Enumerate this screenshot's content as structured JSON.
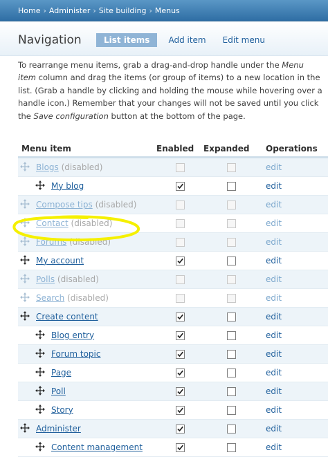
{
  "breadcrumb": [
    "Home",
    "Administer",
    "Site building",
    "Menus"
  ],
  "page_title": "Navigation",
  "tabs": [
    {
      "label": "List items",
      "active": true
    },
    {
      "label": "Add item",
      "active": false
    },
    {
      "label": "Edit menu",
      "active": false
    }
  ],
  "help": {
    "t1": "To rearrange menu items, grab a drag-and-drop handle under the ",
    "em1": "Menu item",
    "t2": " column and drag the items (or group of items) to a new location in the list. (Grab a handle by clicking and holding the mouse while hovering over a handle icon.) Remember that your changes will not be saved until you click the ",
    "em2": "Save configuration",
    "t3": " button at the bottom of the page."
  },
  "table": {
    "headers": {
      "item": "Menu item",
      "enabled": "Enabled",
      "expanded": "Expanded",
      "operations": "Operations"
    },
    "rows": [
      {
        "label": "Blogs",
        "suffix": "(disabled)",
        "depth": 0,
        "enabled": false,
        "expanded": false,
        "disabled": true,
        "op": "edit"
      },
      {
        "label": "My blog",
        "suffix": "",
        "depth": 1,
        "enabled": true,
        "expanded": false,
        "disabled": false,
        "op": "edit"
      },
      {
        "label": "Compose tips",
        "suffix": "(disabled)",
        "depth": 0,
        "enabled": false,
        "expanded": false,
        "disabled": true,
        "op": "edit"
      },
      {
        "label": "Contact",
        "suffix": "(disabled)",
        "depth": 0,
        "enabled": false,
        "expanded": false,
        "disabled": true,
        "op": "edit"
      },
      {
        "label": "Forums",
        "suffix": "(disabled)",
        "depth": 0,
        "enabled": false,
        "expanded": false,
        "disabled": true,
        "op": "edit"
      },
      {
        "label": "My account",
        "suffix": "",
        "depth": 0,
        "enabled": true,
        "expanded": false,
        "disabled": false,
        "op": "edit"
      },
      {
        "label": "Polls",
        "suffix": "(disabled)",
        "depth": 0,
        "enabled": false,
        "expanded": false,
        "disabled": true,
        "op": "edit"
      },
      {
        "label": "Search",
        "suffix": "(disabled)",
        "depth": 0,
        "enabled": false,
        "expanded": false,
        "disabled": true,
        "op": "edit"
      },
      {
        "label": "Create content",
        "suffix": "",
        "depth": 0,
        "enabled": true,
        "expanded": false,
        "disabled": false,
        "op": "edit"
      },
      {
        "label": "Blog entry",
        "suffix": "",
        "depth": 1,
        "enabled": true,
        "expanded": false,
        "disabled": false,
        "op": "edit"
      },
      {
        "label": "Forum topic",
        "suffix": "",
        "depth": 1,
        "enabled": true,
        "expanded": false,
        "disabled": false,
        "op": "edit"
      },
      {
        "label": "Page",
        "suffix": "",
        "depth": 1,
        "enabled": true,
        "expanded": false,
        "disabled": false,
        "op": "edit"
      },
      {
        "label": "Poll",
        "suffix": "",
        "depth": 1,
        "enabled": true,
        "expanded": false,
        "disabled": false,
        "op": "edit"
      },
      {
        "label": "Story",
        "suffix": "",
        "depth": 1,
        "enabled": true,
        "expanded": false,
        "disabled": false,
        "op": "edit"
      },
      {
        "label": "Administer",
        "suffix": "",
        "depth": 0,
        "enabled": true,
        "expanded": false,
        "disabled": false,
        "op": "edit"
      },
      {
        "label": "Content management",
        "suffix": "",
        "depth": 1,
        "enabled": true,
        "expanded": false,
        "disabled": false,
        "op": "edit"
      }
    ]
  },
  "colors": {
    "link": "#1f5f9c",
    "link_disabled": "#8cb2d4",
    "annotation": "#f5f000",
    "header_bar": "#2f6ea4"
  },
  "annotation": {
    "shape": "hand-drawn-ellipse",
    "target": "Contact"
  }
}
